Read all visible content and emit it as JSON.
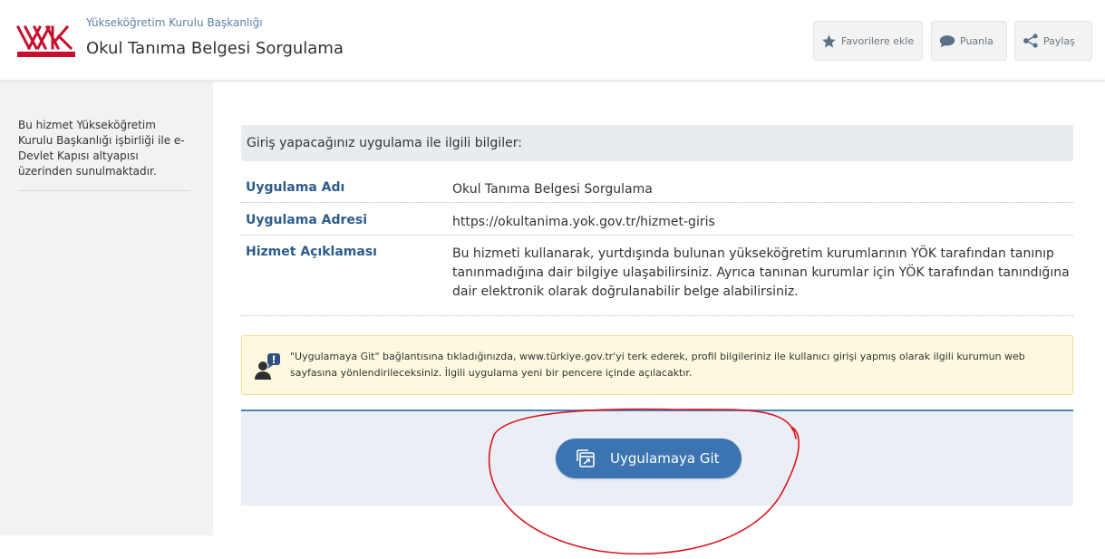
{
  "header": {
    "institution": "Yükseköğretim Kurulu Başkanlığı",
    "title": "Okul Tanıma Belgesi Sorgulama",
    "buttons": {
      "favorite": "Favorilere ekle",
      "rate": "Puanla",
      "share": "Paylaş"
    }
  },
  "sidebar": {
    "text": "Bu hizmet Yükseköğretim Kurulu Başkanlığı işbirliği ile e-Devlet Kapısı altyapısı üzerinden sunulmaktadır."
  },
  "info": {
    "heading": "Giriş yapacağınız uygulama ile ilgili bilgiler:",
    "rows": [
      {
        "label": "Uygulama Adı",
        "value": "Okul Tanıma Belgesi Sorgulama"
      },
      {
        "label": "Uygulama Adresi",
        "value": "https://okultanima.yok.gov.tr/hizmet-giris"
      },
      {
        "label": "Hizmet Açıklaması",
        "value": "Bu hizmeti kullanarak, yurtdışında bulunan yükseköğretim kurumlarının YÖK tarafından tanınıp tanınmadığına dair bilgiye ulaşabilirsiniz. Ayrıca tanınan kurumlar için YÖK tarafından tanındığına dair elektronik olarak doğrulanabilir belge alabilirsiniz."
      }
    ]
  },
  "notice": {
    "text": "\"Uygulamaya Git\" bağlantısına tıkladığınızda, www.türkiye.gov.tr'yi terk ederek, profil bilgileriniz ile kullanıcı girişi yapmış olarak ilgili kurumun web sayfasına yönlendirileceksiniz. İlgili uygulama yeni bir pencere içinde açılacaktır."
  },
  "action": {
    "go_label": "Uygulamaya Git"
  },
  "icons": {
    "logo": "yok-logo",
    "favorite": "star-icon",
    "rate": "speech-bubble-icon",
    "share": "share-icon",
    "notice": "user-alert-icon",
    "go": "external-window-icon"
  },
  "colors": {
    "link_blue": "#2c5c8b",
    "button_blue": "#3b74b1",
    "logo_red": "#c8102e",
    "annotation_red": "#d9151f"
  }
}
